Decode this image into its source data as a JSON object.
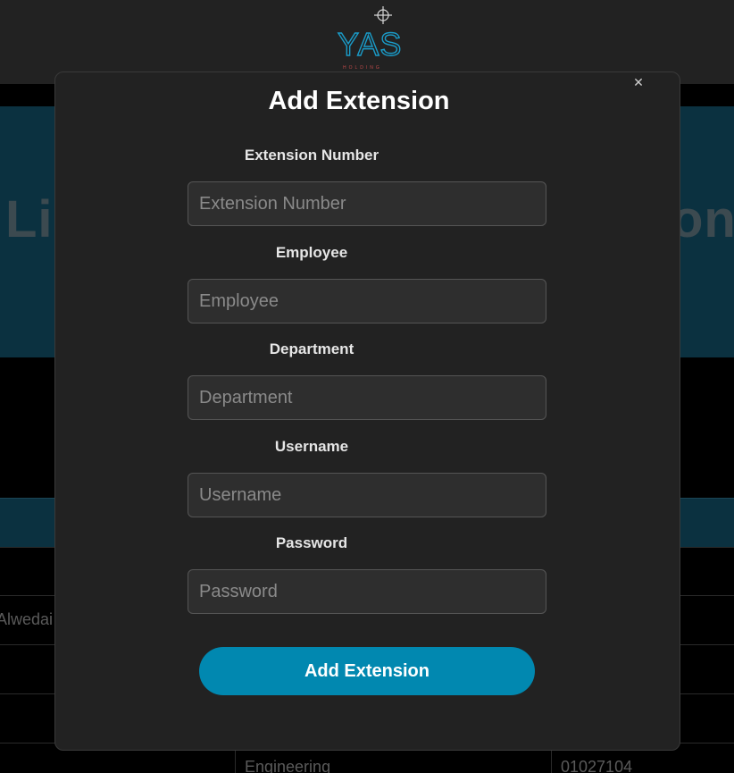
{
  "header": {
    "logo_text": "YAS",
    "logo_subtext": "HOLDING"
  },
  "background": {
    "hero_left_text": "Li",
    "hero_right_text": "on",
    "table_rows": [
      {
        "name": "Alwedai",
        "department": "",
        "phone": ""
      },
      {
        "name": "",
        "department": "Engineering",
        "phone": "01027104"
      }
    ]
  },
  "modal": {
    "title": "Add Extension",
    "close_icon": "close-icon",
    "fields": [
      {
        "label": "Extension Number",
        "placeholder": "Extension Number",
        "value": ""
      },
      {
        "label": "Employee",
        "placeholder": "Employee",
        "value": ""
      },
      {
        "label": "Department",
        "placeholder": "Department",
        "value": ""
      },
      {
        "label": "Username",
        "placeholder": "Username",
        "value": ""
      },
      {
        "label": "Password",
        "placeholder": "Password",
        "value": ""
      }
    ],
    "submit_label": "Add Extension"
  },
  "colors": {
    "accent": "#0188b0",
    "modal_bg": "#222222",
    "hero_bg": "#0b3140"
  }
}
